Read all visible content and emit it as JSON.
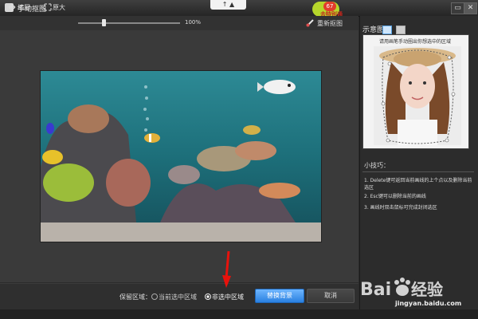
{
  "window": {
    "title": "手动抠图",
    "minimize_glyph": "▭",
    "close_glyph": "✕"
  },
  "center_tab": "↑ ▲",
  "badge": {
    "count": "67",
    "text": "去特别通"
  },
  "toolbar": {
    "shrink_icon": "arrows-in-icon",
    "shrink_label": "缩屏",
    "enlarge_icon": "arrows-out-icon",
    "enlarge_label": "原大",
    "zoom_value": "100%",
    "zoom_level": 0.28,
    "redraw_icon": "brush-icon",
    "redraw_label": "重新抠图"
  },
  "bottom": {
    "keep_label": "保留区域：",
    "option1": "当前选中区域",
    "option2": "非选中区域",
    "selected": "非选中区域",
    "replace_button": "替换背景",
    "cancel_button": "取消"
  },
  "right_panel": {
    "preview_label": "示意图",
    "preview_hint": "请用画笔手动圈出你想选中的区域",
    "tips_title": "小技巧：",
    "tips": [
      "1. Delete键可返回当前画线的上个点以及删除当前选区",
      "2. Esc键可以删除当前的画线",
      "3. 画线时双击鼠标可完成封闭选区"
    ]
  },
  "watermark": {
    "logo": "Bai 经验",
    "url": "jingyan.baidu.com"
  },
  "colors": {
    "accent": "#2a80e0",
    "badge": "#e23c2c",
    "arrow": "#e8120c"
  }
}
